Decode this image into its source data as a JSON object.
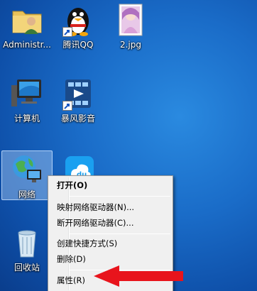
{
  "desktop": {
    "icons": [
      {
        "label": "Administr...",
        "icon": "user-folder-icon"
      },
      {
        "label": "腾讯QQ",
        "icon": "qq-penguin-icon"
      },
      {
        "label": "2.jpg",
        "icon": "image-file-icon"
      },
      {
        "label": "计算机",
        "icon": "computer-icon"
      },
      {
        "label": "暴风影音",
        "icon": "media-player-icon"
      },
      {
        "label": "网络",
        "icon": "network-globe-icon"
      },
      {
        "label": "",
        "icon": "baidu-cloud-icon"
      },
      {
        "label": "回收站",
        "icon": "recycle-bin-icon"
      }
    ]
  },
  "context_menu": {
    "items": [
      {
        "label": "打开(O)",
        "bold": true
      },
      {
        "label": "映射网络驱动器(N)..."
      },
      {
        "label": "断开网络驱动器(C)..."
      },
      {
        "label": "创建快捷方式(S)"
      },
      {
        "label": "删除(D)"
      },
      {
        "label": "属性(R)"
      }
    ]
  },
  "colors": {
    "desktop_bg": "#1a6cc8",
    "menu_bg": "#f0f0f0",
    "arrow": "#e8141c"
  }
}
